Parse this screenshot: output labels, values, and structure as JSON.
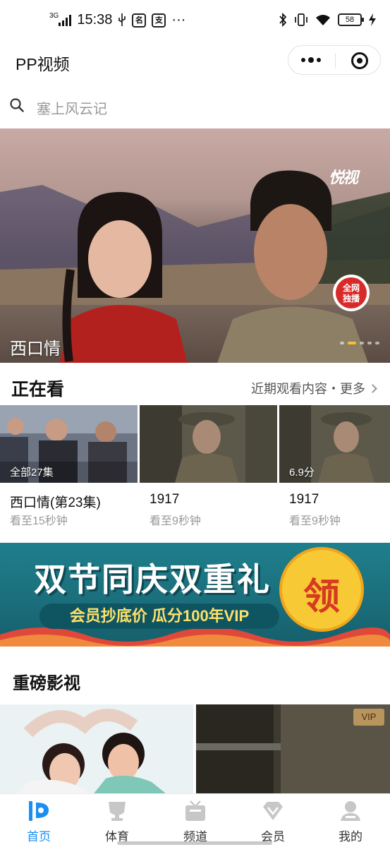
{
  "status_bar": {
    "network": "3G",
    "time": "15:38",
    "icon_sim": "名",
    "icon_pay": "支",
    "more": "···",
    "battery": "58"
  },
  "header": {
    "title": "PP视频"
  },
  "search": {
    "placeholder": "塞上风云记"
  },
  "banner": {
    "title": "西口情",
    "logo": "悦视",
    "badge_line1": "全网",
    "badge_line2": "独播",
    "slide_count": 5,
    "active_slide": 2
  },
  "watching": {
    "title": "正在看",
    "more": "近期观看内容・更多",
    "items": [
      {
        "badge": "全部27集",
        "title": "西口情(第23集)",
        "progress": "看至15秒钟"
      },
      {
        "badge": "",
        "title": "1917",
        "progress": "看至9秒钟"
      },
      {
        "badge": "6.9分",
        "title": "1917",
        "progress": "看至9秒钟"
      }
    ]
  },
  "promo": {
    "title": "双节同庆双重礼",
    "subtitle": "会员抄底价  瓜分100年VIP",
    "action": "领"
  },
  "featured": {
    "title": "重磅影视",
    "vip_badge": "VIP"
  },
  "tabbar": {
    "items": [
      {
        "label": "首页",
        "icon": "home-icon"
      },
      {
        "label": "体育",
        "icon": "sports-icon"
      },
      {
        "label": "频道",
        "icon": "channel-icon"
      },
      {
        "label": "会员",
        "icon": "vip-icon"
      },
      {
        "label": "我的",
        "icon": "profile-icon"
      }
    ],
    "active_index": 0,
    "active_color": "#1a8ff2"
  }
}
